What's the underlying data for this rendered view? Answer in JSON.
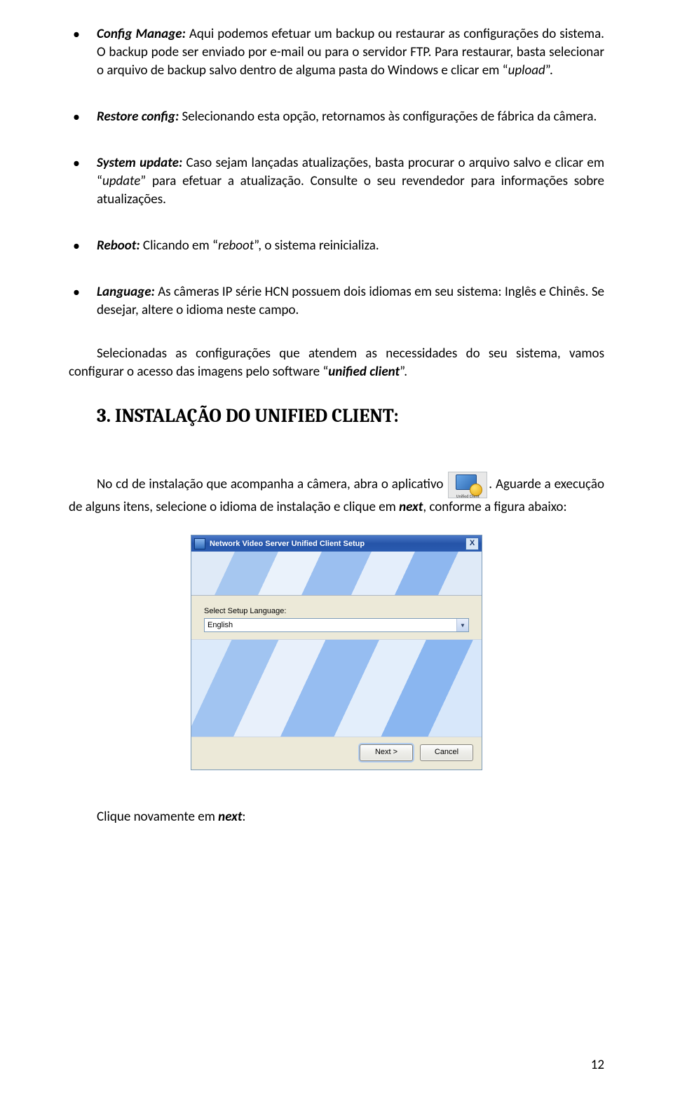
{
  "bullets": {
    "config_manage": {
      "lead": "Config Manage:",
      "text": " Aqui podemos efetuar um backup ou restaurar as configurações do sistema. O backup pode ser enviado por e-mail ou para o servidor FTP. Para restaurar, basta selecionar o arquivo de backup salvo dentro de alguma pasta do Windows e clicar em “",
      "ital1": "upload",
      "tail1": "”."
    },
    "restore_config": {
      "lead": "Restore config:",
      "text": " Selecionando esta opção, retornamos às configurações de fábrica da câmera."
    },
    "system_update": {
      "lead": "System update:",
      "text": " Caso sejam lançadas atualizações, basta procurar o arquivo salvo e clicar em “",
      "ital1": "update",
      "tail1": "” para efetuar a atualização. Consulte o seu revendedor para informações sobre atualizações."
    },
    "reboot": {
      "lead": "Reboot:",
      "text": " Clicando em “",
      "ital1": "reboot",
      "tail1": "”, o sistema reinicializa."
    },
    "language": {
      "lead": "Language:",
      "text": " As câmeras IP série HCN possuem dois idiomas em seu sistema: Inglês e Chinês. Se desejar, altere o idioma neste campo."
    }
  },
  "plain_para": {
    "pre": "Selecionadas as configurações que atendem as necessidades do seu sistema, vamos configurar o acesso das imagens pelo software “",
    "ital": "unified client",
    "post": "”."
  },
  "heading": "3. INSTALAÇÃO DO UNIFIED CLIENT:",
  "intro": {
    "pre": "No cd de instalação que acompanha a câmera, abra o aplicativo ",
    "post1": ". Aguarde a execução de alguns itens, selecione o idioma de instalação e clique em ",
    "ital": "next",
    "post2": ", conforme a figura abaixo:"
  },
  "icon_caption": "Unified Client",
  "dialog": {
    "title": "Network Video Server Unified Client Setup",
    "close": "X",
    "label": "Select Setup Language:",
    "value": "English",
    "next": "Next >",
    "cancel": "Cancel"
  },
  "after_dialog": {
    "pre": "Clique novamente em ",
    "ital": "next",
    "post": ":"
  },
  "page_number": "12"
}
